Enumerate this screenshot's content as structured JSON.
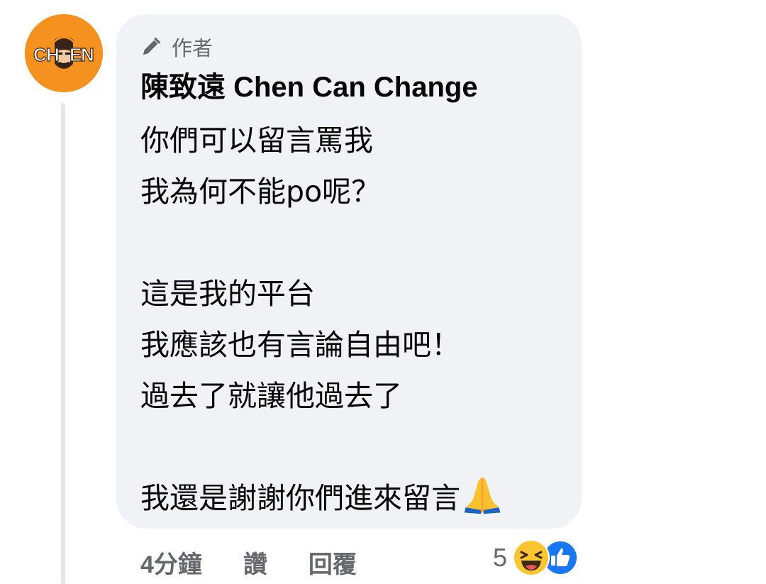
{
  "avatar": {
    "text": "CHEN",
    "bg_color": "#f5921f"
  },
  "comment": {
    "author_badge_label": "作者",
    "author_badge_icon": "pencil-icon",
    "author_name": "陳致遠 Chen Can Change",
    "lines": [
      "你們可以留言罵我",
      "我為何不能po呢？",
      "",
      "這是我的平台",
      "我應該也有言論自由吧！",
      "過去了就讓他過去了",
      "",
      "我還是謝謝你們進來留言"
    ],
    "trailing_emoji": "folded-hands-emoji",
    "bubble_color": "#f0f2f5"
  },
  "actions": {
    "timestamp": "4分鐘",
    "like_label": "讚",
    "reply_label": "回覆"
  },
  "reactions": {
    "count": "5",
    "icons": [
      "haha-reaction-icon",
      "like-reaction-icon"
    ],
    "like_color": "#1877f2"
  }
}
